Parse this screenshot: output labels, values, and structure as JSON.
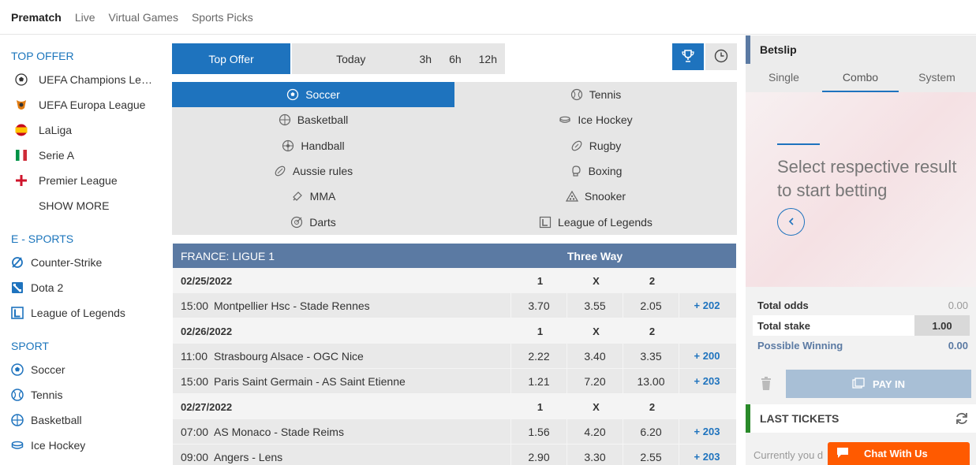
{
  "topnav": {
    "items": [
      {
        "label": "Prematch",
        "active": true
      },
      {
        "label": "Live",
        "active": false
      },
      {
        "label": "Virtual Games",
        "active": false
      },
      {
        "label": "Sports Picks",
        "active": false
      }
    ]
  },
  "sidebar": {
    "top_offer_title": "TOP OFFER",
    "top_offer": [
      {
        "label": "UEFA Champions League",
        "icon": "ball-icon"
      },
      {
        "label": "UEFA Europa League",
        "icon": "europa-icon"
      },
      {
        "label": "LaLiga",
        "icon": "spain-flag-icon"
      },
      {
        "label": "Serie A",
        "icon": "italy-flag-icon"
      },
      {
        "label": "Premier League",
        "icon": "england-flag-icon"
      }
    ],
    "show_more": "SHOW MORE",
    "esports_title": "E - SPORTS",
    "esports": [
      {
        "label": "Counter-Strike",
        "icon": "counter-strike-icon"
      },
      {
        "label": "Dota 2",
        "icon": "dota2-icon"
      },
      {
        "label": "League of Legends",
        "icon": "lol-icon"
      }
    ],
    "sport_title": "SPORT",
    "sports": [
      {
        "label": "Soccer",
        "icon": "soccer-icon"
      },
      {
        "label": "Tennis",
        "icon": "tennis-icon"
      },
      {
        "label": "Basketball",
        "icon": "basketball-icon"
      },
      {
        "label": "Ice Hockey",
        "icon": "ice-hockey-icon"
      }
    ]
  },
  "filters": {
    "top_offer": "Top Offer",
    "today": "Today",
    "hours": [
      "3h",
      "6h",
      "12h"
    ]
  },
  "sports_grid": [
    {
      "label": "Soccer",
      "icon": "soccer-icon",
      "active": true
    },
    {
      "label": "Tennis",
      "icon": "tennis-icon",
      "active": false
    },
    {
      "label": "Basketball",
      "icon": "basketball-icon",
      "active": false
    },
    {
      "label": "Ice Hockey",
      "icon": "ice-hockey-icon",
      "active": false
    },
    {
      "label": "Handball",
      "icon": "handball-icon",
      "active": false
    },
    {
      "label": "Rugby",
      "icon": "rugby-icon",
      "active": false
    },
    {
      "label": "Aussie rules",
      "icon": "aussie-rules-icon",
      "active": false
    },
    {
      "label": "Boxing",
      "icon": "boxing-icon",
      "active": false
    },
    {
      "label": "MMA",
      "icon": "mma-icon",
      "active": false
    },
    {
      "label": "Snooker",
      "icon": "snooker-icon",
      "active": false
    },
    {
      "label": "Darts",
      "icon": "darts-icon",
      "active": false
    },
    {
      "label": "League of Legends",
      "icon": "lol-icon",
      "active": false
    }
  ],
  "odds": {
    "league": "FRANCE: LIGUE 1",
    "market": "Three Way",
    "days": [
      {
        "date": "02/25/2022",
        "cols": [
          "1",
          "X",
          "2"
        ],
        "matches": [
          {
            "time": "15:00",
            "name": "Montpellier Hsc - Stade Rennes",
            "o1": "3.70",
            "ox": "3.55",
            "o2": "2.05",
            "more": "+ 202"
          }
        ]
      },
      {
        "date": "02/26/2022",
        "cols": [
          "1",
          "X",
          "2"
        ],
        "matches": [
          {
            "time": "11:00",
            "name": "Strasbourg Alsace - OGC Nice",
            "o1": "2.22",
            "ox": "3.40",
            "o2": "3.35",
            "more": "+ 200"
          },
          {
            "time": "15:00",
            "name": "Paris Saint Germain - AS Saint Etienne",
            "o1": "1.21",
            "ox": "7.20",
            "o2": "13.00",
            "more": "+ 203"
          }
        ]
      },
      {
        "date": "02/27/2022",
        "cols": [
          "1",
          "X",
          "2"
        ],
        "matches": [
          {
            "time": "07:00",
            "name": "AS Monaco - Stade Reims",
            "o1": "1.56",
            "ox": "4.20",
            "o2": "6.20",
            "more": "+ 203"
          },
          {
            "time": "09:00",
            "name": "Angers - Lens",
            "o1": "2.90",
            "ox": "3.30",
            "o2": "2.55",
            "more": "+ 203"
          }
        ]
      }
    ]
  },
  "betslip": {
    "title": "Betslip",
    "tabs": [
      {
        "label": "Single",
        "active": false
      },
      {
        "label": "Combo",
        "active": true
      },
      {
        "label": "System",
        "active": false
      }
    ],
    "message": "Select respective result to start betting",
    "total_odds_label": "Total odds",
    "total_odds": "0.00",
    "total_stake_label": "Total stake",
    "total_stake": "1.00",
    "possible_label": "Possible Winning",
    "possible": "0.00",
    "pay_in": "PAY IN",
    "last_tickets": "LAST TICKETS",
    "currently": "Currently you d"
  },
  "chat": {
    "label": "Chat With Us"
  },
  "colors": {
    "accent": "#1e73be",
    "header": "#5b7aa3",
    "chat": "#ff5a00",
    "tickets": "#2a8a2a"
  }
}
